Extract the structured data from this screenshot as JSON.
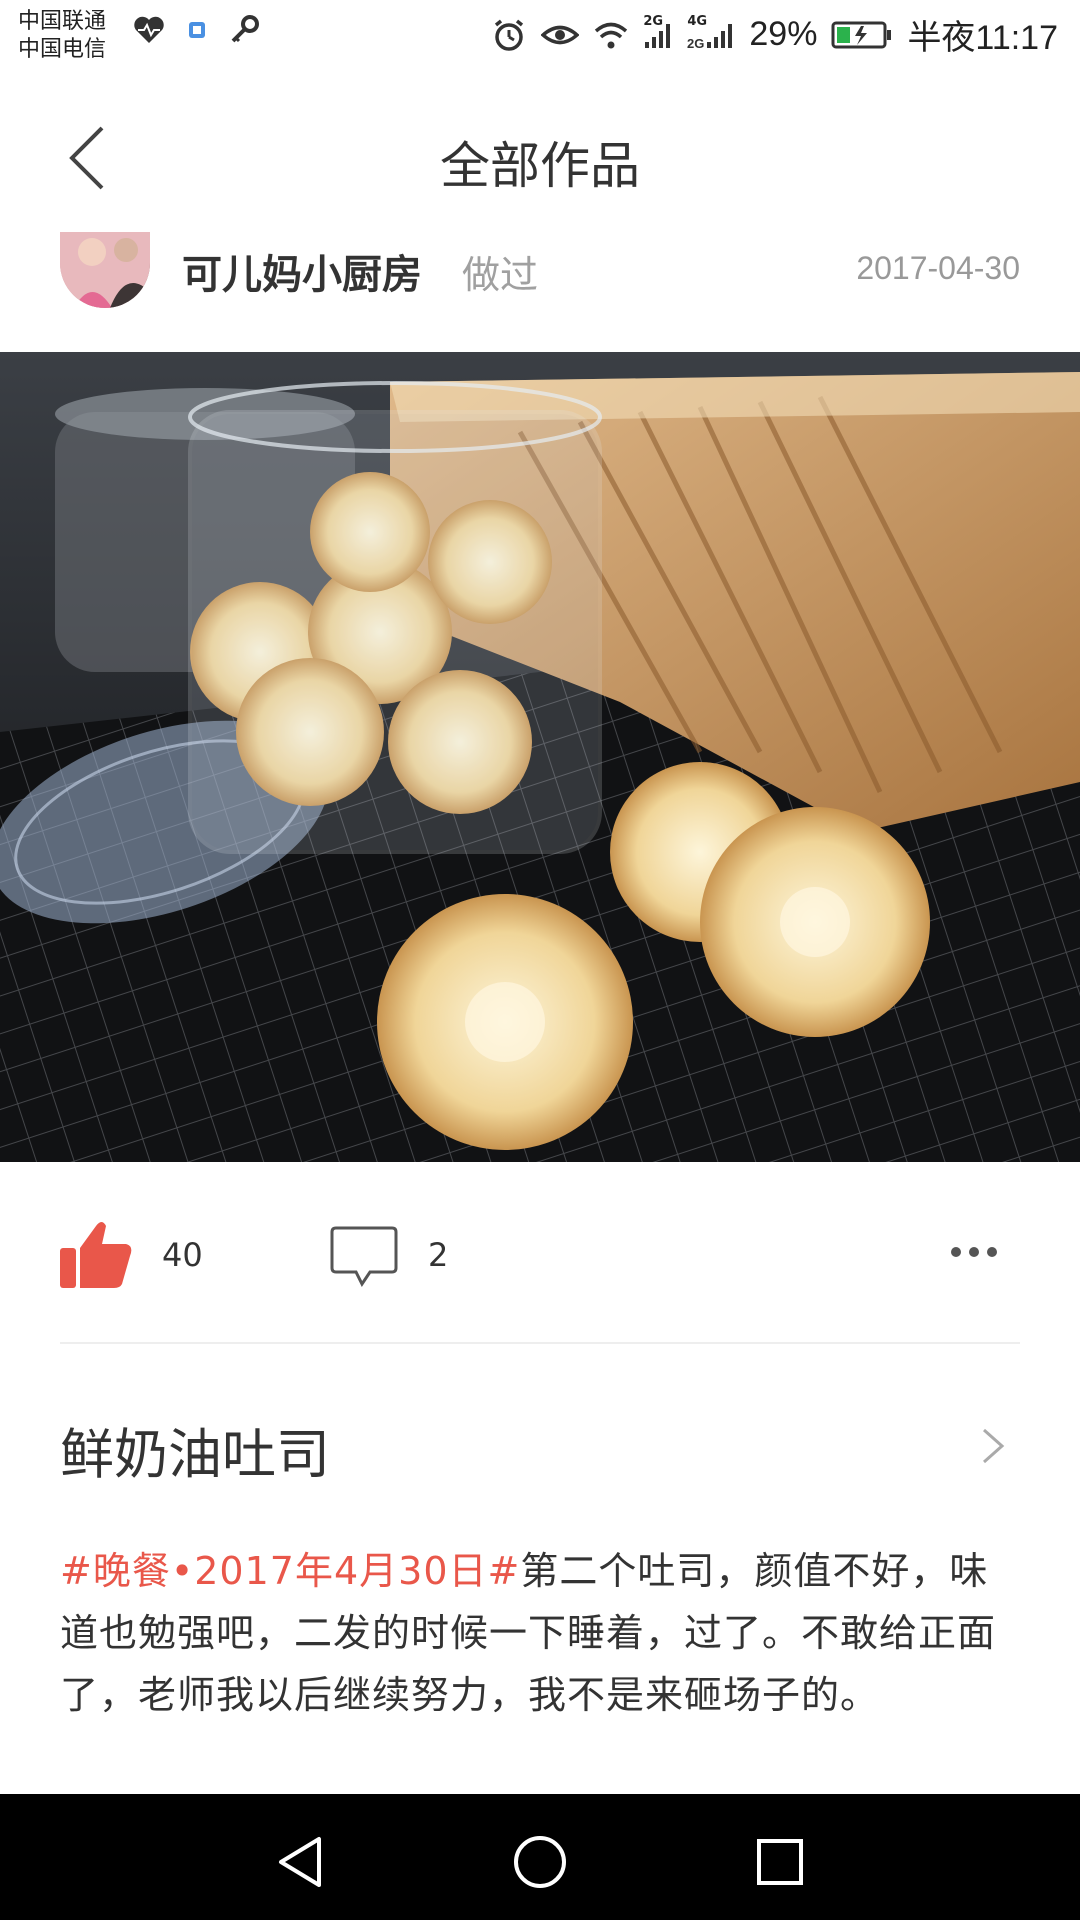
{
  "status_bar": {
    "carrier_1": "中国联通",
    "carrier_2": "中国电信",
    "left_icons": [
      "heartbeat-icon",
      "app-icon",
      "key-icon"
    ],
    "right_icons": [
      "alarm-icon",
      "eye-icon",
      "wifi-icon",
      "signal-2g-icon",
      "signal-4g-icon"
    ],
    "signal_2g_label": "2G",
    "signal_4g_label": "4G",
    "battery_percent": "29%",
    "battery_level": 0.29,
    "time": "半夜11:17"
  },
  "header": {
    "title": "全部作品",
    "back_icon": "chevron-left-icon"
  },
  "author": {
    "name": "可儿妈小厨房",
    "action": "做过",
    "date": "2017-04-30"
  },
  "photo": {
    "subject": "cookies-and-bread-photo"
  },
  "actions": {
    "like_count": "40",
    "comment_count": "2",
    "like_icon": "thumbs-up-icon",
    "comment_icon": "comment-icon",
    "more_icon": "more-dots-icon"
  },
  "recipe": {
    "title": "鲜奶油吐司"
  },
  "description": {
    "hashtag": "#晚餐•2017年4月30日#",
    "text": "第二个吐司，颜值不好，味道也勉强吧，二发的时候一下睡着，过了。不敢给正面了，老师我以后继续努力，我不是来砸场子的。"
  },
  "colors": {
    "accent": "#e9574a",
    "text": "#333333",
    "muted": "#999999",
    "navbar": "#000000"
  },
  "navbar": {
    "icons": [
      "nav-back-icon",
      "nav-home-icon",
      "nav-recents-icon"
    ]
  }
}
